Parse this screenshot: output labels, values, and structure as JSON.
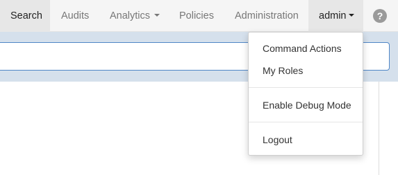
{
  "navbar": {
    "items": [
      {
        "label": "Search"
      },
      {
        "label": "Audits"
      },
      {
        "label": "Analytics"
      },
      {
        "label": "Policies"
      },
      {
        "label": "Administration"
      },
      {
        "label": "admin"
      }
    ],
    "help_icon": "?"
  },
  "user_menu": {
    "items": [
      {
        "label": "Command Actions"
      },
      {
        "label": "My Roles"
      },
      {
        "label": "Enable Debug Mode"
      },
      {
        "label": "Logout"
      }
    ]
  },
  "colors": {
    "navbar_bg": "#f5f5f5",
    "active_bg": "#e7e7e7",
    "search_band_bg": "#d5e0ec",
    "input_border": "#4f86c6"
  }
}
